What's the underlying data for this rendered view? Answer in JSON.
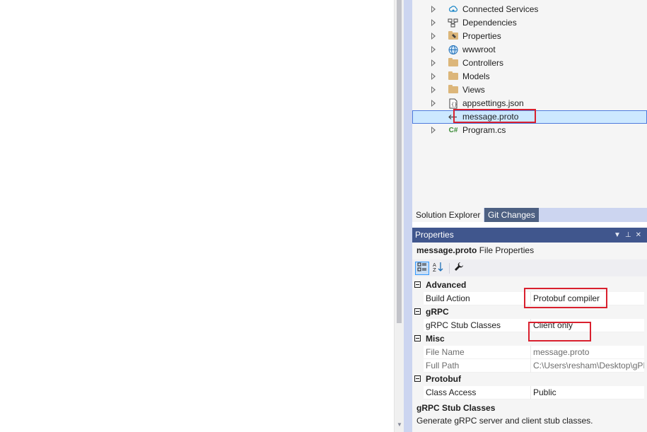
{
  "solution_explorer": {
    "items": [
      {
        "label": "Connected Services",
        "icon": "connected-services-icon"
      },
      {
        "label": "Dependencies",
        "icon": "dependencies-icon"
      },
      {
        "label": "Properties",
        "icon": "properties-folder-icon"
      },
      {
        "label": "wwwroot",
        "icon": "globe-icon"
      },
      {
        "label": "Controllers",
        "icon": "folder-icon"
      },
      {
        "label": "Models",
        "icon": "folder-icon"
      },
      {
        "label": "Views",
        "icon": "folder-icon"
      },
      {
        "label": "appsettings.json",
        "icon": "json-file-icon"
      },
      {
        "label": "message.proto",
        "icon": "proto-file-icon",
        "selected": true
      },
      {
        "label": "Program.cs",
        "icon": "csharp-file-icon"
      }
    ],
    "tabs": [
      "Solution Explorer",
      "Git Changes"
    ],
    "active_tab": "Solution Explorer"
  },
  "properties": {
    "title": "Properties",
    "object_name": "message.proto",
    "object_type": "File Properties",
    "categories": [
      {
        "name": "Advanced",
        "rows": [
          {
            "key": "Build Action",
            "value": "Protobuf compiler"
          }
        ]
      },
      {
        "name": "gRPC",
        "rows": [
          {
            "key": "gRPC Stub Classes",
            "value": "Client only"
          }
        ]
      },
      {
        "name": "Misc",
        "rows": [
          {
            "key": "File Name",
            "value": "message.proto"
          },
          {
            "key": "Full Path",
            "value": "C:\\Users\\resham\\Desktop\\gPI"
          }
        ]
      },
      {
        "name": "Protobuf",
        "rows": [
          {
            "key": "Class Access",
            "value": "Public"
          }
        ]
      }
    ],
    "description_title": "gRPC Stub Classes",
    "description_text": "Generate gRPC server and client stub classes."
  },
  "colors": {
    "frame": "#ccd5f0",
    "selection": "#cce8ff",
    "title_bar": "#40568d",
    "highlight": "#d9202e"
  }
}
